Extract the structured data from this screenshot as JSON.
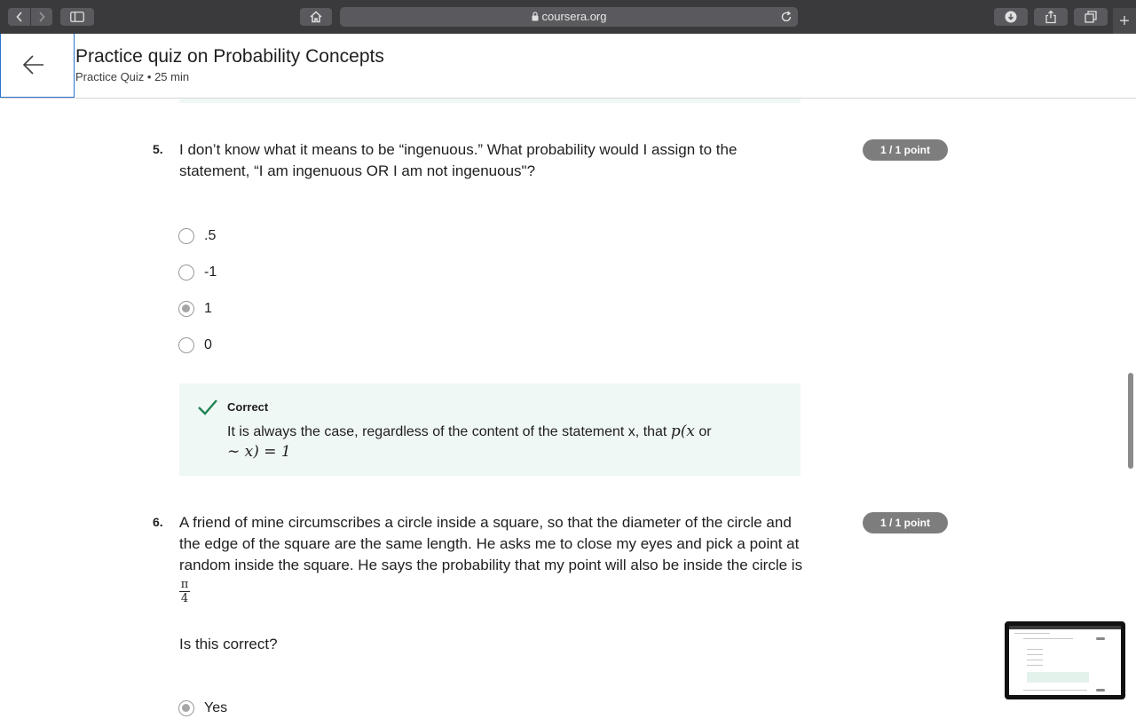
{
  "browser": {
    "url": "coursera.org"
  },
  "header": {
    "title": "Practice quiz on Probability Concepts",
    "subtitle": "Practice Quiz • 25 min"
  },
  "questions": [
    {
      "number": "5.",
      "text": "I don’t know what it means to be “ingenuous.” What probability would I assign to the statement, “I am ingenuous OR I am not ingenuous\"?",
      "points": "1 / 1 point",
      "options": [
        {
          "label": ".5",
          "selected": false
        },
        {
          "label": "-1",
          "selected": false
        },
        {
          "label": "1",
          "selected": true
        },
        {
          "label": "0",
          "selected": false
        }
      ],
      "feedback": {
        "title": "Correct",
        "text": "It is always the case, regardless of the content of the statement x, that ",
        "math_a": "p(x",
        "math_or": " or",
        "math_b": "∼ x) = 1"
      }
    },
    {
      "number": "6.",
      "text": "A friend of mine circumscribes a circle inside a square, so that the diameter of the circle and the edge of the square are the same length. He asks me to close my eyes and pick a point at random inside the square. He says the probability that my point will also be inside the circle is",
      "fraction_num": "π",
      "fraction_den": "4",
      "points": "1 / 1 point",
      "prompt": "Is this correct?",
      "options": [
        {
          "label": "Yes",
          "selected": true
        }
      ]
    }
  ],
  "colors": {
    "chrome": "#3a3a3c",
    "pill": "#7d7d7d",
    "feedback_bg": "#f0f8f5",
    "check": "#1f8354",
    "back_border": "#2a73cc"
  }
}
